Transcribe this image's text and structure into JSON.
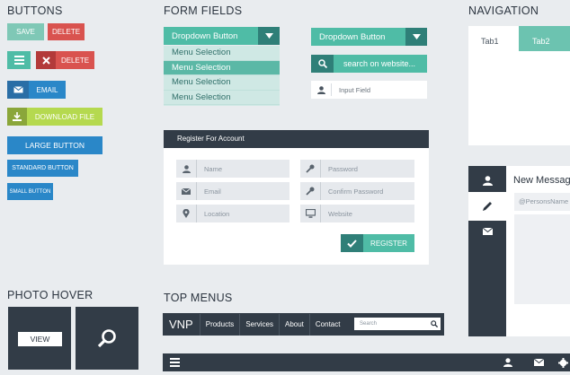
{
  "sections": {
    "buttons": "BUTTONS",
    "form_fields": "FORM FIELDS",
    "navigation": "NAVIGATION",
    "photo_hover": "PHOTO HOVER",
    "top_menus": "TOP MENUS"
  },
  "buttons": {
    "save": "SAVE",
    "delete": "DELETE",
    "delete2": "DELETE",
    "email": "EMAIL",
    "download": "DOWNLOAD FILE",
    "large": "LARGE BUTTON",
    "standard": "STANDARD BUTTON",
    "small": "SMALL BUTTON"
  },
  "form": {
    "dropdown_label": "Dropdown Button",
    "dropdown_items": [
      "Menu Selection",
      "Menu Selection",
      "Menu Selection",
      "Menu Selection"
    ],
    "dropdown2_label": "Dropdown Button",
    "search_placeholder": "search on website...",
    "input_placeholder": "Input Field"
  },
  "register": {
    "title": "Register For Account",
    "name": "Name",
    "password": "Password",
    "email": "Email",
    "confirm": "Confirm Password",
    "location": "Location",
    "website": "Website",
    "submit": "REGISTER"
  },
  "navigation": {
    "tab1": "Tab1",
    "tab2": "Tab2",
    "message_title": "New Messag",
    "persons_placeholder": "@PersonsName"
  },
  "photo_hover": {
    "view": "VIEW"
  },
  "top_menu": {
    "brand": "VNP",
    "items": [
      "Products",
      "Services",
      "About",
      "Contact"
    ],
    "search_placeholder": "Search"
  },
  "colors": {
    "teal": "#4fbca6",
    "dark_teal": "#2f7f78",
    "navy": "#323c47",
    "red": "#d9534f",
    "dark_red": "#b33a3a",
    "blue": "#2a87c8",
    "dark_blue": "#2a6ea6",
    "lime": "#b5d94f",
    "olive": "#8aa63a"
  }
}
